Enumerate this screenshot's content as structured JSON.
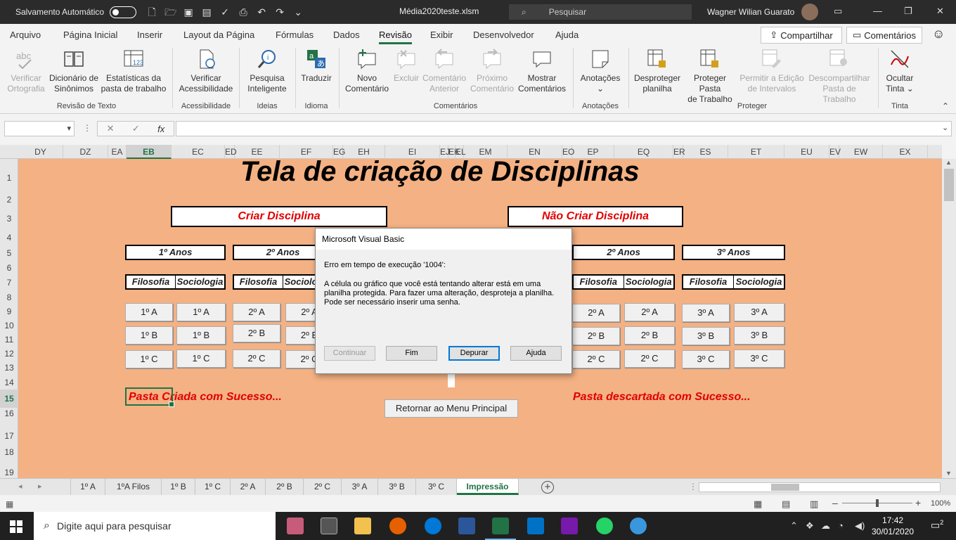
{
  "titlebar": {
    "autosave_label": "Salvamento Automático",
    "document_title": "Média2020teste.xlsm",
    "search_placeholder": "Pesquisar",
    "user_name": "Wagner Wilian Guarato"
  },
  "ribbon_tabs": [
    "Arquivo",
    "Página Inicial",
    "Inserir",
    "Layout da Página",
    "Fórmulas",
    "Dados",
    "Revisão",
    "Exibir",
    "Desenvolvedor",
    "Ajuda"
  ],
  "active_tab": "Revisão",
  "share_label": "Compartilhar",
  "comments_label": "Comentários",
  "ribbon": {
    "buttons": [
      {
        "label1": "Verificar",
        "label2": "Ortografia",
        "disabled": true
      },
      {
        "label1": "Dicionário de",
        "label2": "Sinônimos",
        "disabled": false
      },
      {
        "label1": "Estatísticas da",
        "label2": "pasta de trabalho",
        "disabled": false
      },
      {
        "label1": "Verificar",
        "label2": "Acessibilidade",
        "disabled": false
      },
      {
        "label1": "Pesquisa",
        "label2": "Inteligente",
        "disabled": false
      },
      {
        "label1": "Traduzir",
        "label2": "",
        "disabled": false
      },
      {
        "label1": "Novo",
        "label2": "Comentário",
        "disabled": false
      },
      {
        "label1": "Excluir",
        "label2": "",
        "disabled": true
      },
      {
        "label1": "Comentário",
        "label2": "Anterior",
        "disabled": true
      },
      {
        "label1": "Próximo",
        "label2": "Comentário",
        "disabled": true
      },
      {
        "label1": "Mostrar",
        "label2": "Comentários",
        "disabled": false
      },
      {
        "label1": "Anotações",
        "label2": "⌄",
        "disabled": false
      },
      {
        "label1": "Desproteger",
        "label2": "planilha",
        "disabled": false
      },
      {
        "label1": "Proteger Pasta",
        "label2": "de Trabalho",
        "disabled": false
      },
      {
        "label1": "Permitir a Edição",
        "label2": "de Intervalos",
        "disabled": true
      },
      {
        "label1": "Descompartilhar",
        "label2": "Pasta de Trabalho",
        "disabled": true
      },
      {
        "label1": "Ocultar",
        "label2": "Tinta ⌄",
        "disabled": false
      }
    ],
    "groups": [
      "Revisão de Texto",
      "Acessibilidade",
      "Ideias",
      "Idioma",
      "Comentários",
      "Anotações",
      "Proteger",
      "Tinta"
    ]
  },
  "columns": [
    "DY",
    "DZ",
    "EA",
    "EB",
    "EC",
    "ED",
    "EE",
    "EF",
    "EG",
    "EH",
    "EI",
    "EJ",
    "EK",
    "EL",
    "EM",
    "EN",
    "EO",
    "EP",
    "EQ",
    "ER",
    "ES",
    "ET",
    "EU",
    "EV",
    "EW",
    "EX"
  ],
  "selected_column": "EB",
  "rows": [
    "1",
    "2",
    "3",
    "4",
    "5",
    "6",
    "7",
    "8",
    "9",
    "10",
    "11",
    "12",
    "13",
    "14",
    "15",
    "16",
    "17",
    "18",
    "19"
  ],
  "selected_row": "15",
  "sheet": {
    "title": "Tela de criação de Disciplinas",
    "create_label": "Criar Disciplina",
    "no_create_label": "Não Criar Disciplina",
    "headers": [
      "1º Anos",
      "2º Anos",
      "2º Anos",
      "3º Anos"
    ],
    "subjects": [
      "Filosofia",
      "Sociologia"
    ],
    "buttons_left": [
      "1º A",
      "1º A",
      "2º A",
      "2º A",
      "1º B",
      "1º B",
      "2º B",
      "2º B",
      "1º C",
      "1º C",
      "2º C",
      "2º C"
    ],
    "buttons_right": [
      "2º A",
      "2º A",
      "3º A",
      "3º A",
      "2º B",
      "2º B",
      "3º B",
      "3º B",
      "2º C",
      "2º C",
      "3º C",
      "3º C"
    ],
    "success_created": "Pasta Criada com Sucesso...",
    "success_discarded": "Pasta descartada com Sucesso...",
    "return_button": "Retornar ao Menu Principal"
  },
  "dialog": {
    "title": "Microsoft Visual Basic",
    "error_line": "Erro em tempo de execução '1004':",
    "message": "A célula ou gráfico que você está tentando alterar está em uma planilha protegida. Para fazer uma alteração, desproteja a planilha. Pode ser necessário inserir uma senha.",
    "buttons": {
      "continue": "Continuar",
      "end": "Fim",
      "debug": "Depurar",
      "help": "Ajuda"
    }
  },
  "sheet_tabs": [
    "1º A",
    "1ºA Filos",
    "1º B",
    "1º C",
    "2º A",
    "2º B",
    "2º C",
    "3º A",
    "3º B",
    "3º C",
    "Impressão"
  ],
  "active_sheet": "Impressão",
  "statusbar": {
    "zoom": "100%"
  },
  "taskbar": {
    "search_placeholder": "Digite aqui para pesquisar",
    "time": "17:42",
    "date": "30/01/2020",
    "notifications": "2"
  }
}
